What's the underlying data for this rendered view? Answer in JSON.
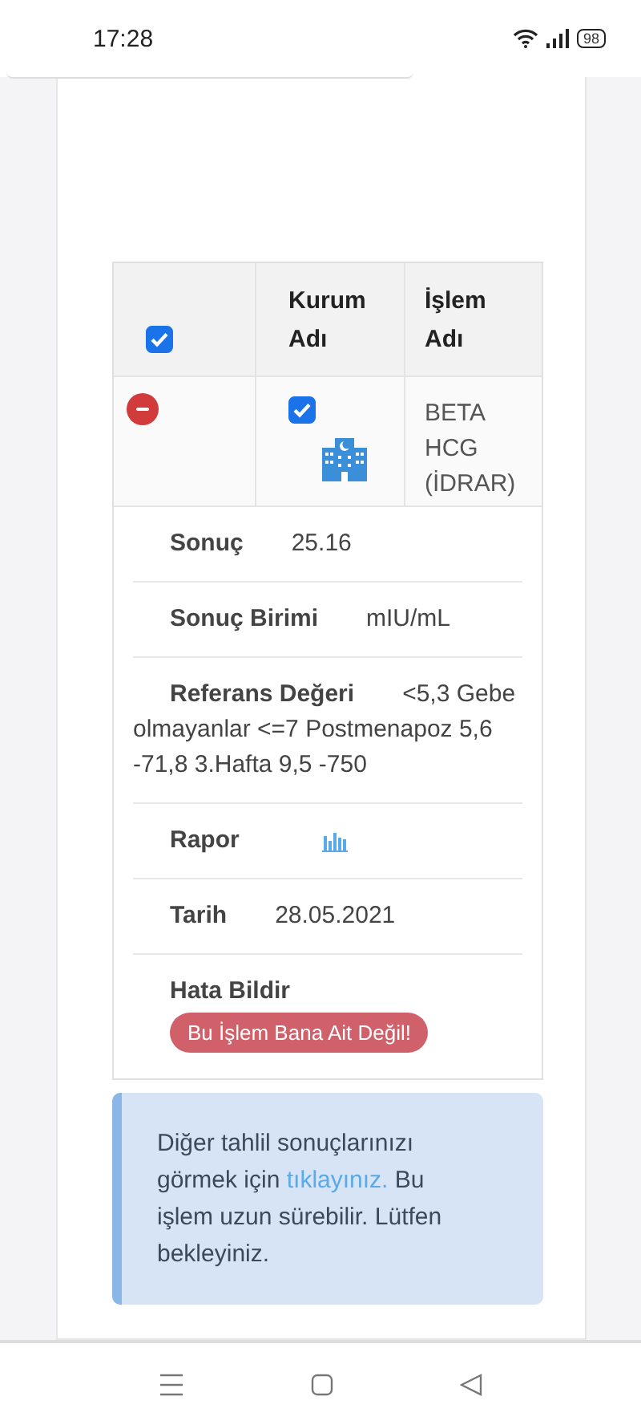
{
  "status_bar": {
    "time": "17:28",
    "battery": "98"
  },
  "table": {
    "header_checked": true,
    "columns": [
      "Kurum Adı",
      "İşlem Adı"
    ],
    "row": {
      "checked": true,
      "name": "BETA HCG (İDRAR)"
    }
  },
  "details": [
    {
      "kind": "text",
      "label": "Sonuç",
      "value": "25.16"
    },
    {
      "kind": "text",
      "label": "Sonuç Birimi",
      "value": "mIU/mL"
    },
    {
      "kind": "text",
      "label": "Referans Değeri",
      "value": "<5,3 Gebe olmayanlar <=7 Postmenapoz 5,6 -71,8 3.Hafta 9,5 -750"
    },
    {
      "kind": "chart",
      "label": "Rapor"
    },
    {
      "kind": "text",
      "label": "Tarih",
      "value": "28.05.2021"
    },
    {
      "kind": "button",
      "label": "Hata Bildir",
      "value": "Bu İşlem Bana Ait Değil!"
    }
  ],
  "alert": {
    "before": "Diğer tahlil sonuçlarınızı görmek için ",
    "link": "tıklayınız.",
    "after": " Bu işlem uzun sürebilir. Lütfen bekleyiniz."
  }
}
